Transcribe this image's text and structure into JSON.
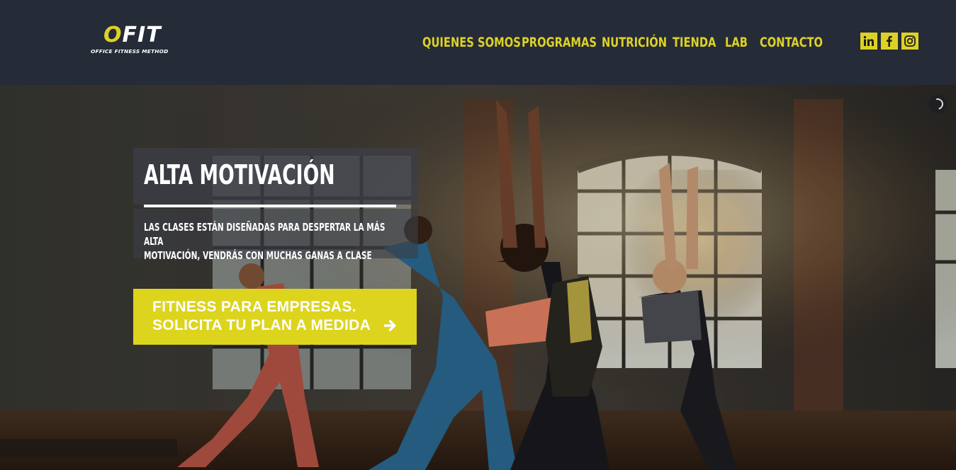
{
  "header": {
    "logo": {
      "mark_a": "O",
      "mark_b": "FIT",
      "tagline": "OFFICE FITNESS METHOD"
    },
    "nav": [
      {
        "label": "QUIENES SOMOS"
      },
      {
        "label": "PROGRAMAS"
      },
      {
        "label": "NUTRICIÓN"
      },
      {
        "label": "TIENDA"
      },
      {
        "label": "LAB"
      },
      {
        "label": "CONTACTO"
      }
    ],
    "social": [
      {
        "icon": "linkedin-icon"
      },
      {
        "icon": "facebook-icon"
      },
      {
        "icon": "instagram-icon"
      }
    ]
  },
  "hero": {
    "title": "ALTA MOTIVACIÓN",
    "description_line1": "LAS CLASES ESTÁN DISEÑADAS PARA DESPERTAR LA MÁS ALTA",
    "description_line2": "MOTIVACIÓN, VENDRÁS CON MUCHAS GANAS A CLASE",
    "cta_line1": "FITNESS PARA EMPRESAS.",
    "cta_line2": "SOLICITA TU PLAN A MEDIDA",
    "cta_icon": "arrow-right-icon"
  },
  "colors": {
    "header_bg": "#252b37",
    "accent": "#ddd224",
    "text_light": "#ffffff"
  }
}
